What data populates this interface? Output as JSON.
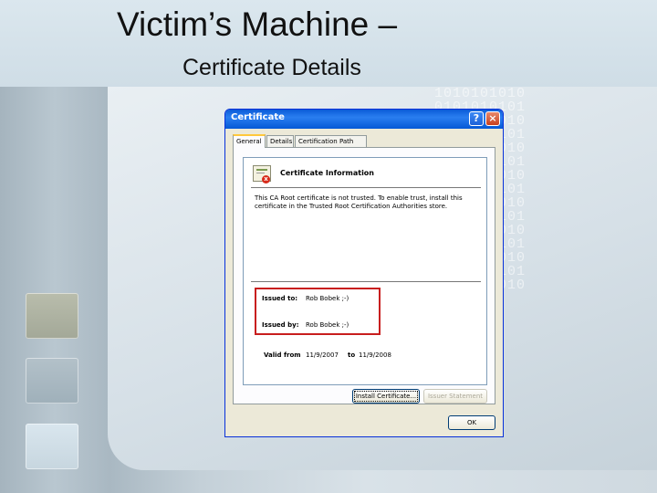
{
  "slide": {
    "title": "Victim’s Machine –",
    "subtitle": "Certificate Details"
  },
  "background": {
    "binary_rows": [
      "1010101010",
      "0101010101",
      "1010101010",
      "0101010101",
      "1010101010",
      "0101010101",
      "1010101010",
      "0101010101",
      "1010101010",
      "0101010101",
      "1010101010",
      "0101010101",
      "1010101010",
      "0101010101",
      "1010101010"
    ]
  },
  "dialog": {
    "title": "Certificate",
    "help_label": "?",
    "close_label": "×",
    "tabs": [
      "General",
      "Details",
      "Certification Path"
    ],
    "active_tab": "General",
    "info_heading": "Certificate Information",
    "warning": "This CA Root certificate is not trusted. To enable trust, install this certificate in the Trusted Root Certification Authorities store.",
    "issued_to_label": "Issued to:",
    "issued_to_value": "Rob Bobek ;-)",
    "issued_by_label": "Issued by:",
    "issued_by_value": "Rob Bobek ;-)",
    "valid_from_label": "Valid from",
    "valid_from_value": "11/9/2007",
    "valid_to_label": "to",
    "valid_to_value": "11/9/2008",
    "install_button": "Install Certificate...",
    "issuer_button": "Issuer Statement",
    "ok_button": "OK"
  },
  "colors": {
    "titlebar": "#0a5bd8",
    "highlight_border": "#c81e1e",
    "active_tab_accent": "#ffc83c"
  }
}
